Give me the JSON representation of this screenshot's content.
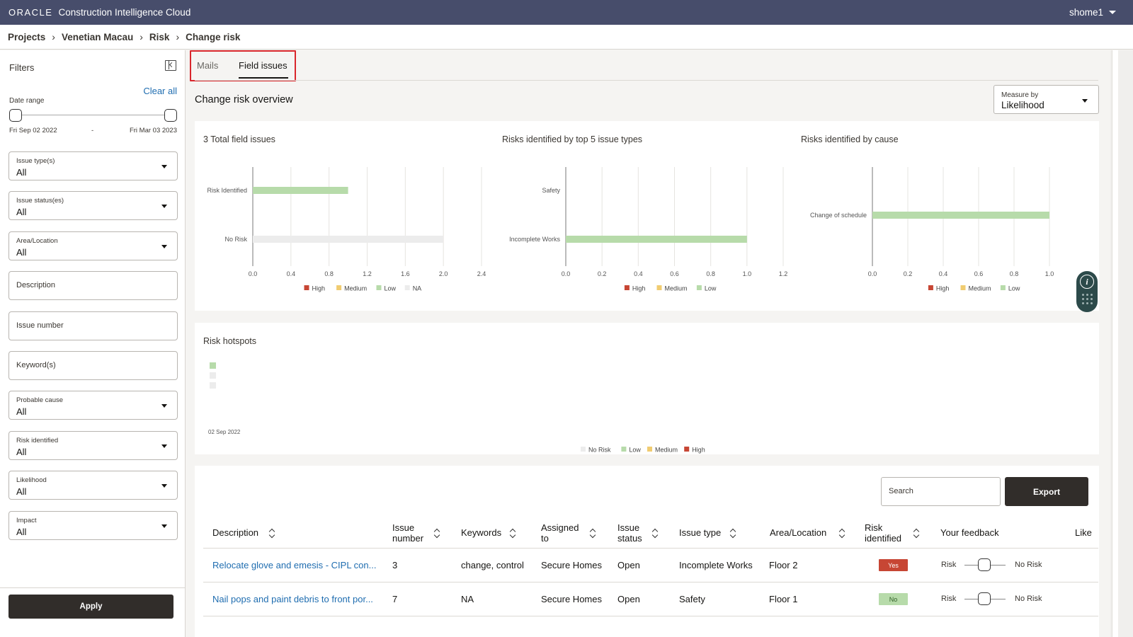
{
  "app": {
    "logo": "ORACLE",
    "name": "Construction Intelligence Cloud",
    "user": "shome1"
  },
  "breadcrumb": [
    "Projects",
    "Venetian Macau",
    "Risk",
    "Change risk"
  ],
  "filters": {
    "title": "Filters",
    "clear_all": "Clear all",
    "date_range": {
      "label": "Date range",
      "start": "Fri Sep 02 2022",
      "end": "Fri Mar 03 2023",
      "sep": "-"
    },
    "fields": [
      {
        "label": "Issue type(s)",
        "value": "All",
        "type": "select"
      },
      {
        "label": "Issue status(es)",
        "value": "All",
        "type": "select"
      },
      {
        "label": "Area/Location",
        "value": "All",
        "type": "select"
      },
      {
        "placeholder": "Description",
        "type": "text"
      },
      {
        "placeholder": "Issue number",
        "type": "text"
      },
      {
        "placeholder": "Keyword(s)",
        "type": "text"
      },
      {
        "label": "Probable cause",
        "value": "All",
        "type": "select"
      },
      {
        "label": "Risk identified",
        "value": "All",
        "type": "select"
      },
      {
        "label": "Likelihood",
        "value": "All",
        "type": "select"
      },
      {
        "label": "Impact",
        "value": "All",
        "type": "select"
      }
    ],
    "apply": "Apply"
  },
  "tabs": [
    {
      "label": "Mails",
      "active": false
    },
    {
      "label": "Field issues",
      "active": true
    }
  ],
  "overview": {
    "title": "Change risk overview",
    "measure_label": "Measure by",
    "measure_value": "Likelihood"
  },
  "colors": {
    "high": "#c74634",
    "medium": "#f0cc71",
    "low": "#b7dbaa",
    "na": "#ececec",
    "link": "#1f6db0",
    "topbar": "#474d6b"
  },
  "chart_data": [
    {
      "type": "bar",
      "title": "3 Total field issues",
      "categories": [
        "Risk Identified",
        "No Risk"
      ],
      "series": [
        {
          "name": "Low",
          "values": [
            1,
            0
          ]
        },
        {
          "name": "NA",
          "values": [
            0,
            2
          ]
        }
      ],
      "xticks": [
        "0.0",
        "0.4",
        "0.8",
        "1.2",
        "1.6",
        "2.0",
        "2.4"
      ],
      "xlim": [
        0,
        2.4
      ],
      "legend": [
        "High",
        "Medium",
        "Low",
        "NA"
      ],
      "legend_position": "bottom",
      "orientation": "horizontal"
    },
    {
      "type": "bar",
      "title": "Risks identified by top 5 issue types",
      "categories": [
        "Safety",
        "Incomplete Works"
      ],
      "series": [
        {
          "name": "Low",
          "values": [
            0,
            1
          ]
        }
      ],
      "xticks": [
        "0.0",
        "0.2",
        "0.4",
        "0.6",
        "0.8",
        "1.0",
        "1.2"
      ],
      "xlim": [
        0,
        1.2
      ],
      "legend": [
        "High",
        "Medium",
        "Low"
      ],
      "legend_position": "bottom",
      "orientation": "horizontal"
    },
    {
      "type": "bar",
      "title": "Risks identified by cause",
      "categories": [
        "Change of schedule"
      ],
      "series": [
        {
          "name": "Low",
          "values": [
            1
          ]
        }
      ],
      "xticks": [
        "0.0",
        "0.2",
        "0.4",
        "0.6",
        "0.8",
        "1.0"
      ],
      "xlim": [
        0,
        1.2
      ],
      "legend": [
        "High",
        "Medium",
        "Low"
      ],
      "legend_position": "bottom",
      "orientation": "horizontal"
    },
    {
      "type": "heatmap",
      "title": "Risk hotspots",
      "x": [
        "02 Sep 2022"
      ],
      "legend": [
        "No Risk",
        "Low",
        "Medium",
        "High"
      ],
      "legend_position": "bottom"
    }
  ],
  "table": {
    "search_placeholder": "Search",
    "export": "Export",
    "columns": [
      "Description",
      "Issue number",
      "Keywords",
      "Assigned to",
      "Issue status",
      "Issue type",
      "Area/Location",
      "Risk identified",
      "Your feedback",
      "Like"
    ],
    "rows": [
      {
        "description": "Relocate glove and emesis - CIPL con...",
        "issue_number": "3",
        "keywords": "change, control",
        "assigned_to": "Secure Homes",
        "status": "Open",
        "issue_type": "Incomplete Works",
        "area": "Floor 2",
        "risk": "Yes",
        "fb_left": "Risk",
        "fb_right": "No Risk"
      },
      {
        "description": "Nail pops and paint debris to front por...",
        "issue_number": "7",
        "keywords": "NA",
        "assigned_to": "Secure Homes",
        "status": "Open",
        "issue_type": "Safety",
        "area": "Floor 1",
        "risk": "No",
        "fb_left": "Risk",
        "fb_right": "No Risk"
      }
    ]
  }
}
